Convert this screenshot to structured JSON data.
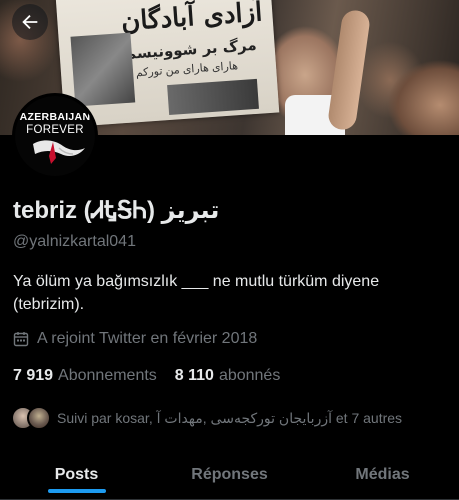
{
  "banner": {
    "newspaper_headline": "آزادی آبادگان",
    "newspaper_sub": "مرگ بر شوونیسم فارس",
    "newspaper_sub2": "هارای هارای من تورکم"
  },
  "avatar": {
    "line1": "AZERBAIJAN",
    "line2": "FOREVER"
  },
  "profile": {
    "display_name": "tebriz (ᏗᎿᎦᏂ) تبریز",
    "handle": "@yalnizkartal041",
    "bio": "Ya ölüm ya bağımsızlık ___  ne mutlu türküm diyene (tebrizim).",
    "joined": "A rejoint Twitter en février 2018"
  },
  "stats": {
    "following_count": "7 919",
    "following_label": "Abonnements",
    "followers_count": "8 110",
    "followers_label": "abonnés"
  },
  "followed_by": "Suivi par kosar, آزربایجان تورکجه‌سی ,مهدات آ et 7 autres",
  "tabs": [
    {
      "label": "Posts"
    },
    {
      "label": "Réponses"
    },
    {
      "label": "Médias"
    }
  ],
  "colors": {
    "background": "#000000",
    "text_primary": "#e7e9ea",
    "text_secondary": "#71767b",
    "accent": "#1d9bf0"
  },
  "icons": {
    "back": "arrow-left-icon",
    "calendar": "calendar-icon"
  }
}
